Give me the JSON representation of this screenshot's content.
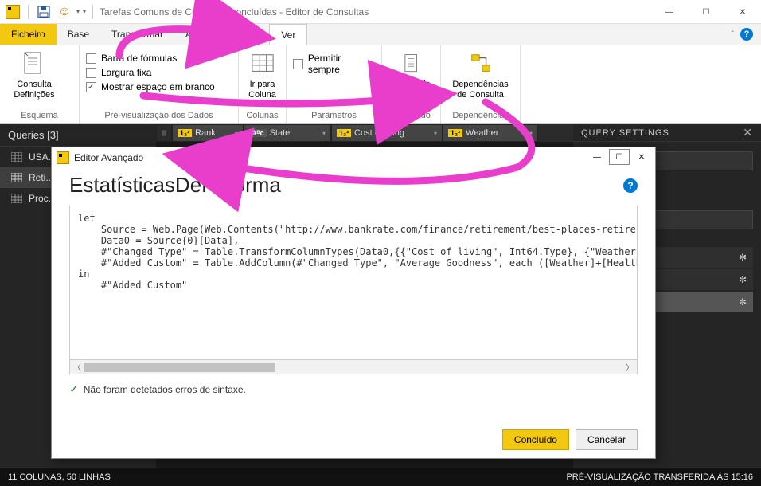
{
  "window": {
    "title": "Tarefas Comuns de Consulta - concluídas - Editor de Consultas"
  },
  "tabs": {
    "file": "Ficheiro",
    "base": "Base",
    "transformar": "Transformar",
    "adicionar": "Adicionar Coluna",
    "ver": "Ver"
  },
  "ribbon": {
    "consulta_def": "Consulta\nDefinições",
    "esquema_group": "Esquema",
    "barra_formulas": "Barra de fórmulas",
    "largura_fixa": "Largura fixa",
    "mostrar_espaco": "Mostrar espaço em branco",
    "previs_group": "Pré-visualização dos Dados",
    "ir_para_coluna": "Ir para\nColuna",
    "colunas_group": "Colunas",
    "permitir_sempre": "Permitir sempre",
    "parametros_group": "Parâmetros",
    "avancado_editor": "Avançado\nEditor",
    "avancado_group": "Avançado",
    "dependencias": "Dependências\nde Consulta",
    "dependencias_group": "Dependências"
  },
  "queries": {
    "header": "Queries [3]",
    "items": [
      "USA...",
      "Reti...",
      "Proc..."
    ]
  },
  "grid": {
    "columns": [
      {
        "type": "1₂³",
        "name": "Rank"
      },
      {
        "type": "Aᴮc",
        "name": "State"
      },
      {
        "type": "1₂³",
        "name": "Cost of living"
      },
      {
        "type": "1₂³",
        "name": "Weather"
      }
    ]
  },
  "settings": {
    "header": "QUERY SETTINGS"
  },
  "status": {
    "left": "11 COLUNAS, 50 LINHAS",
    "right": "PRÉ-VISUALIZAÇÃO TRANSFERIDA ÀS 15:16"
  },
  "dialog": {
    "title": "Editor Avançado",
    "heading": "EstatísticasDeReforma",
    "code": "let\n    Source = Web.Page(Web.Contents(\"http://www.bankrate.com/finance/retirement/best-places-retire-how-s\n    Data0 = Source{0}[Data],\n    #\"Changed Type\" = Table.TransformColumnTypes(Data0,{{\"Cost of living\", Int64.Type}, {\"Weather\", Int\n    #\"Added Custom\" = Table.AddColumn(#\"Changed Type\", \"Average Goodness\", each ([Weather]+[Health care\nin\n    #\"Added Custom\"",
    "syntax_ok": "Não foram detetados erros de sintaxe.",
    "done": "Concluído",
    "cancel": "Cancelar"
  }
}
